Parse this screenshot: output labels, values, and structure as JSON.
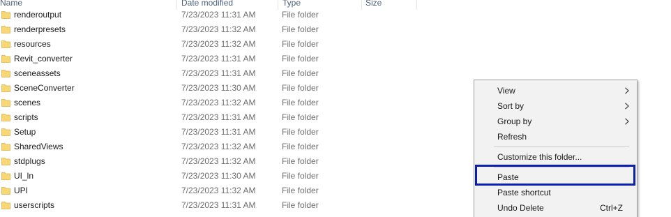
{
  "columns": {
    "name": "Name",
    "date_modified": "Date modified",
    "type": "Type",
    "size": "Size"
  },
  "rows": [
    {
      "name": "renderoutput",
      "date": "7/23/2023 11:31 AM",
      "type": "File folder"
    },
    {
      "name": "renderpresets",
      "date": "7/23/2023 11:32 AM",
      "type": "File folder"
    },
    {
      "name": "resources",
      "date": "7/23/2023 11:32 AM",
      "type": "File folder"
    },
    {
      "name": "Revit_converter",
      "date": "7/23/2023 11:31 AM",
      "type": "File folder"
    },
    {
      "name": "sceneassets",
      "date": "7/23/2023 11:31 AM",
      "type": "File folder"
    },
    {
      "name": "SceneConverter",
      "date": "7/23/2023 11:30 AM",
      "type": "File folder"
    },
    {
      "name": "scenes",
      "date": "7/23/2023 11:32 AM",
      "type": "File folder"
    },
    {
      "name": "scripts",
      "date": "7/23/2023 11:31 AM",
      "type": "File folder"
    },
    {
      "name": "Setup",
      "date": "7/23/2023 11:31 AM",
      "type": "File folder"
    },
    {
      "name": "SharedViews",
      "date": "7/23/2023 11:32 AM",
      "type": "File folder"
    },
    {
      "name": "stdplugs",
      "date": "7/23/2023 11:32 AM",
      "type": "File folder"
    },
    {
      "name": "UI_ln",
      "date": "7/23/2023 11:30 AM",
      "type": "File folder"
    },
    {
      "name": "UPI",
      "date": "7/23/2023 11:32 AM",
      "type": "File folder"
    },
    {
      "name": "userscripts",
      "date": "7/23/2023 11:31 AM",
      "type": "File folder"
    }
  ],
  "context_menu": {
    "view": "View",
    "sort_by": "Sort by",
    "group_by": "Group by",
    "refresh": "Refresh",
    "customize": "Customize this folder...",
    "paste": "Paste",
    "paste_shortcut": "Paste shortcut",
    "undo_delete": "Undo Delete",
    "undo_delete_shortcut": "Ctrl+Z"
  },
  "colors": {
    "folder": "#f8d775",
    "highlight_border": "#0b1fb0",
    "menu_bg": "#f2f2f2"
  },
  "icons": {
    "folder": "folder-icon",
    "submenu": "chevron-right-icon"
  }
}
